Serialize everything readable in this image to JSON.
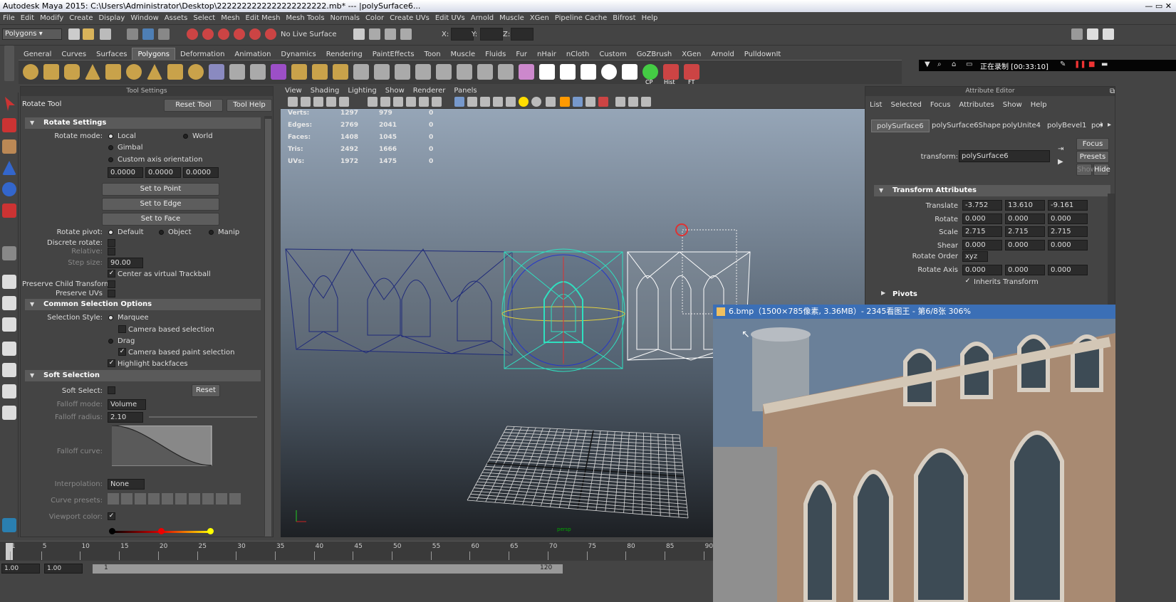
{
  "window": {
    "title": "Autodesk Maya 2015: C:\\Users\\Administrator\\Desktop\\2222222222222222222222.mb*   ---   |polySurface6...",
    "controls": "—  ▭  ✕"
  },
  "menubar": [
    "File",
    "Edit",
    "Modify",
    "Create",
    "Display",
    "Window",
    "Assets",
    "Select",
    "Mesh",
    "Edit Mesh",
    "Mesh Tools",
    "Normals",
    "Color",
    "Create UVs",
    "Edit UVs",
    "Arnold",
    "Muscle",
    "XGen",
    "Pipeline Cache",
    "Bifrost",
    "Help"
  ],
  "statusline": {
    "mode": "Polygons",
    "live_surface": "No Live Surface",
    "x_label": "X:",
    "y_label": "Y:",
    "z_label": "Z:"
  },
  "shelf": {
    "tabs": [
      "General",
      "Curves",
      "Surfaces",
      "Polygons",
      "Deformation",
      "Animation",
      "Dynamics",
      "Rendering",
      "PaintEffects",
      "Toon",
      "Muscle",
      "Fluids",
      "Fur",
      "nHair",
      "nCloth",
      "Custom",
      "GoZBrush",
      "XGen",
      "Arnold",
      "PulldownIt"
    ],
    "active_tab": "Polygons",
    "labels": {
      "cp": "CP",
      "hist": "Hist",
      "ft": "FT"
    }
  },
  "recorder": {
    "text": "正在录制 [00:33:10]"
  },
  "tool_settings": {
    "header": "Tool Settings",
    "tool_name": "Rotate Tool",
    "reset_label": "Reset Tool",
    "help_label": "Tool Help",
    "rotate_settings": {
      "title": "Rotate Settings",
      "mode_label": "Rotate mode:",
      "local": "Local",
      "world": "World",
      "gimbal": "Gimbal",
      "custom": "Custom axis orientation",
      "custom_values": [
        "0.0000",
        "0.0000",
        "0.0000"
      ],
      "set_point": "Set to Point",
      "set_edge": "Set to Edge",
      "set_face": "Set to Face",
      "pivot_label": "Rotate pivot:",
      "pivot_default": "Default",
      "pivot_object": "Object",
      "pivot_manip": "Manip",
      "discrete": "Discrete rotate:",
      "relative": "Relative:",
      "step_label": "Step size:",
      "step_value": "90.00",
      "trackball": "Center as virtual Trackball",
      "preserve_child": "Preserve Child Transform",
      "preserve_uvs": "Preserve UVs"
    },
    "selection": {
      "title": "Common Selection Options",
      "style_label": "Selection Style:",
      "marquee": "Marquee",
      "camera_sel": "Camera based selection",
      "drag": "Drag",
      "camera_paint": "Camera based paint selection",
      "backfaces": "Highlight backfaces"
    },
    "soft": {
      "title": "Soft Selection",
      "soft_label": "Soft Select:",
      "reset": "Reset",
      "falloff_mode_label": "Falloff mode:",
      "falloff_mode": "Volume",
      "falloff_radius_label": "Falloff radius:",
      "falloff_radius": "2.10",
      "curve_label": "Falloff curve:",
      "interp_label": "Interpolation:",
      "interp": "None",
      "presets_label": "Curve presets:",
      "vp_color_label": "Viewport color:"
    }
  },
  "viewport": {
    "menu": [
      "View",
      "Shading",
      "Lighting",
      "Show",
      "Renderer",
      "Panels"
    ],
    "hud": [
      {
        "label": "Verts:",
        "a": "1297",
        "b": "979",
        "c": "0"
      },
      {
        "label": "Edges:",
        "a": "2769",
        "b": "2041",
        "c": "0"
      },
      {
        "label": "Faces:",
        "a": "1408",
        "b": "1045",
        "c": "0"
      },
      {
        "label": "Tris:",
        "a": "2492",
        "b": "1666",
        "c": "0"
      },
      {
        "label": "UVs:",
        "a": "1972",
        "b": "1475",
        "c": "0"
      }
    ],
    "persp": "persp"
  },
  "attribute_editor": {
    "header": "Attribute Editor",
    "menu": [
      "List",
      "Selected",
      "Focus",
      "Attributes",
      "Show",
      "Help"
    ],
    "tabs": [
      "polySurface6",
      "polySurface6Shape",
      "polyUnite4",
      "polyBevel1",
      "pol"
    ],
    "transform_label": "transform:",
    "transform_value": "polySurface6",
    "focus": "Focus",
    "presets": "Presets",
    "show": "Show",
    "hide": "Hide",
    "section": "Transform Attributes",
    "rows": [
      {
        "label": "Translate",
        "values": [
          "-3.752",
          "13.610",
          "-9.161"
        ]
      },
      {
        "label": "Rotate",
        "values": [
          "0.000",
          "0.000",
          "0.000"
        ]
      },
      {
        "label": "Scale",
        "values": [
          "2.715",
          "2.715",
          "2.715"
        ]
      },
      {
        "label": "Shear",
        "values": [
          "0.000",
          "0.000",
          "0.000"
        ]
      }
    ],
    "rotate_order_label": "Rotate Order",
    "rotate_order": "xyz",
    "rotate_axis_label": "Rotate Axis",
    "rotate_axis": [
      "0.000",
      "0.000",
      "0.000"
    ],
    "inherits": "Inherits Transform",
    "pivots": "Pivots"
  },
  "image_viewer": {
    "title": "6.bmp（1500×785像素, 3.36MB）- 2345看图王 - 第6/8张 306%"
  },
  "timeline": {
    "ticks": [
      "1",
      "5",
      "10",
      "15",
      "20",
      "25",
      "30",
      "35",
      "40",
      "45",
      "50",
      "55",
      "60",
      "65",
      "70",
      "75",
      "80",
      "85",
      "90"
    ],
    "start": "1.00",
    "end": "1.00",
    "range_start": "1",
    "range_end": "120"
  }
}
